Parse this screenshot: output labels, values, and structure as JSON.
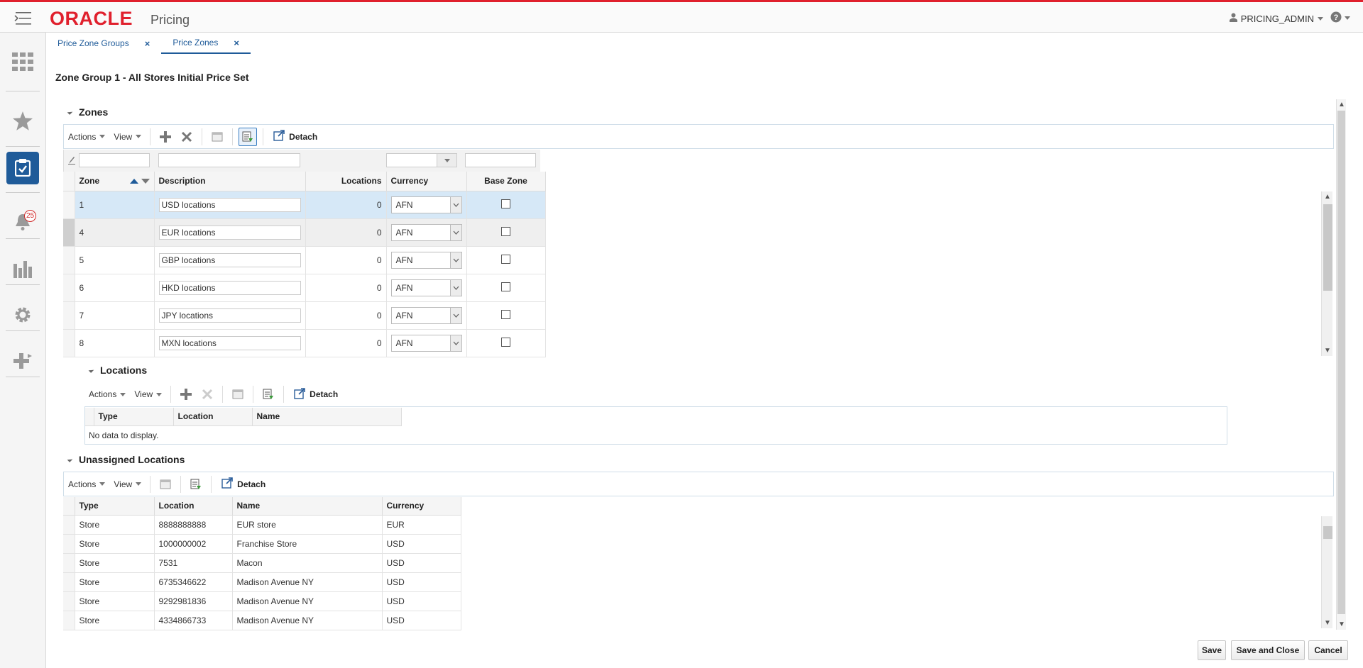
{
  "header": {
    "logo": "ORACLE",
    "app_name": "Pricing",
    "user": "PRICING_ADMIN"
  },
  "sidebar": {
    "items": [
      {
        "icon": "grid-icon"
      },
      {
        "icon": "star-icon"
      },
      {
        "icon": "task-icon"
      },
      {
        "icon": "bell-icon",
        "badge": "25"
      },
      {
        "icon": "chart-icon"
      },
      {
        "icon": "gear-icon"
      },
      {
        "icon": "plus-transfer-icon"
      }
    ]
  },
  "tabs": [
    {
      "label": "Price Zone Groups"
    },
    {
      "label": "Price Zones"
    }
  ],
  "page_title": "Zone Group 1 - All Stores Initial Price Set",
  "zones": {
    "title": "Zones",
    "toolbar": {
      "actions": "Actions",
      "view": "View",
      "detach": "Detach"
    },
    "columns": {
      "zone": "Zone",
      "description": "Description",
      "locations": "Locations",
      "currency": "Currency",
      "base_zone": "Base Zone"
    },
    "rows": [
      {
        "zone": "1",
        "description": "USD locations",
        "locations": "0",
        "currency": "AFN"
      },
      {
        "zone": "4",
        "description": "EUR locations",
        "locations": "0",
        "currency": "AFN"
      },
      {
        "zone": "5",
        "description": "GBP locations",
        "locations": "0",
        "currency": "AFN"
      },
      {
        "zone": "6",
        "description": "HKD locations",
        "locations": "0",
        "currency": "AFN"
      },
      {
        "zone": "7",
        "description": "JPY locations",
        "locations": "0",
        "currency": "AFN"
      },
      {
        "zone": "8",
        "description": "MXN locations",
        "locations": "0",
        "currency": "AFN"
      }
    ]
  },
  "locations": {
    "title": "Locations",
    "toolbar": {
      "actions": "Actions",
      "view": "View",
      "detach": "Detach"
    },
    "columns": {
      "type": "Type",
      "location": "Location",
      "name": "Name"
    },
    "empty": "No data to display."
  },
  "unassigned": {
    "title": "Unassigned Locations",
    "toolbar": {
      "actions": "Actions",
      "view": "View",
      "detach": "Detach"
    },
    "columns": {
      "type": "Type",
      "location": "Location",
      "name": "Name",
      "currency": "Currency"
    },
    "rows": [
      {
        "type": "Store",
        "location": "8888888888",
        "name": "EUR store",
        "currency": "EUR"
      },
      {
        "type": "Store",
        "location": "1000000002",
        "name": "Franchise Store",
        "currency": "USD"
      },
      {
        "type": "Store",
        "location": "7531",
        "name": "Macon",
        "currency": "USD"
      },
      {
        "type": "Store",
        "location": "6735346622",
        "name": "Madison Avenue NY",
        "currency": "USD"
      },
      {
        "type": "Store",
        "location": "9292981836",
        "name": "Madison Avenue NY",
        "currency": "USD"
      },
      {
        "type": "Store",
        "location": "4334866733",
        "name": "Madison Avenue NY",
        "currency": "USD"
      }
    ]
  },
  "footer": {
    "save": "Save",
    "save_close": "Save and Close",
    "cancel": "Cancel"
  },
  "colors": {
    "brand_red": "#e0202d",
    "accent_blue": "#1f5b99",
    "selected_row": "#d6e8f7"
  }
}
